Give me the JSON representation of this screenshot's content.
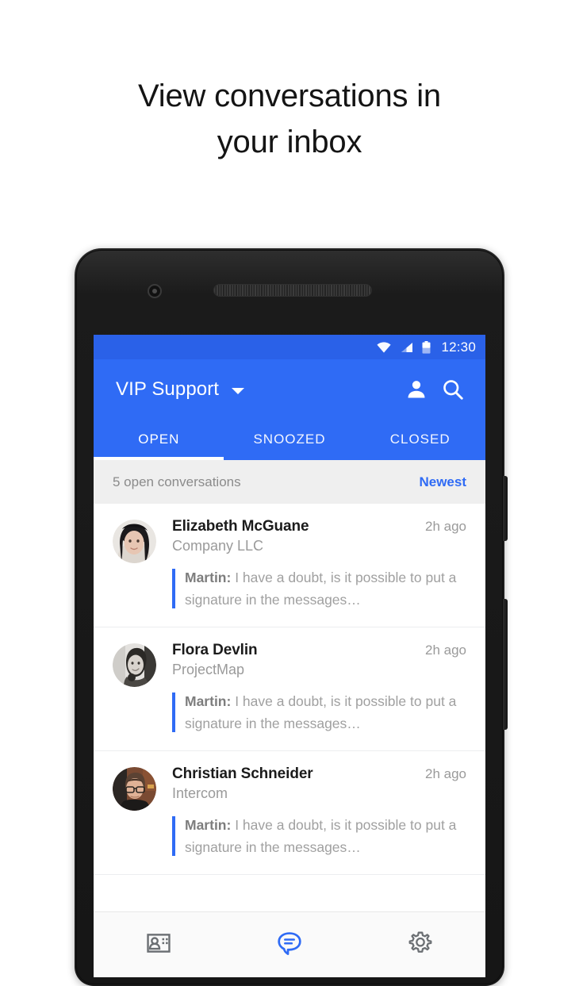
{
  "headline": {
    "line1": "View conversations in",
    "line2": "your inbox"
  },
  "colors": {
    "accent": "#2f6bf5",
    "statusbar": "#2a61e8",
    "filterbar_bg": "#efefef",
    "muted_text": "#9a9a9a",
    "bottomnav_bg": "#fafafa"
  },
  "phone": {
    "statusbar": {
      "time": "12:30",
      "icons": [
        "wifi-icon",
        "signal-icon",
        "battery-icon"
      ]
    },
    "appbar": {
      "title": "VIP Support",
      "dropdown_icon": "chevron-down-icon",
      "actions": [
        {
          "name": "person-icon",
          "label": "Assignee"
        },
        {
          "name": "search-icon",
          "label": "Search"
        }
      ]
    },
    "tabs": [
      {
        "label": "OPEN",
        "active": true
      },
      {
        "label": "SNOOZED",
        "active": false
      },
      {
        "label": "CLOSED",
        "active": false
      }
    ],
    "filterbar": {
      "count_label": "5 open conversations",
      "sort_label": "Newest"
    },
    "conversations": [
      {
        "name": "Elizabeth McGuane",
        "company": "Company LLC",
        "time": "2h ago",
        "preview_author": "Martin:",
        "preview_text": " I have a doubt, is it possible to put a signature in the messages…",
        "avatar": "avatar-elizabeth"
      },
      {
        "name": "Flora Devlin",
        "company": "ProjectMap",
        "time": "2h ago",
        "preview_author": "Martin:",
        "preview_text": " I have a doubt, is it possible to put a signature in the messages…",
        "avatar": "avatar-flora"
      },
      {
        "name": "Christian Schneider",
        "company": "Intercom",
        "time": "2h ago",
        "preview_author": "Martin:",
        "preview_text": " I have a doubt, is it possible to put a signature in the messages…",
        "avatar": "avatar-christian"
      }
    ],
    "bottomnav": [
      {
        "name": "contacts-icon",
        "label": "Contacts",
        "active": false
      },
      {
        "name": "conversations-icon",
        "label": "Conversations",
        "active": true
      },
      {
        "name": "settings-gear-icon",
        "label": "Settings",
        "active": false
      }
    ]
  }
}
